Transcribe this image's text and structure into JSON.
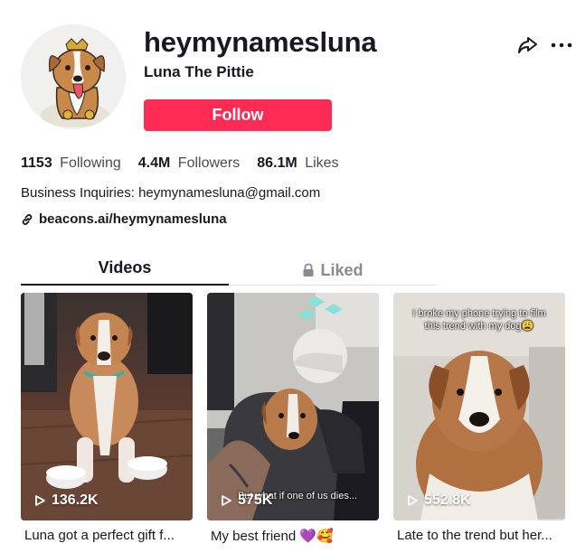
{
  "profile": {
    "username": "heymynamesluna",
    "nickname": "Luna The Pittie",
    "follow_label": "Follow"
  },
  "stats": [
    {
      "value": "1153",
      "label": "Following"
    },
    {
      "value": "4.4M",
      "label": "Followers"
    },
    {
      "value": "86.1M",
      "label": "Likes"
    }
  ],
  "bio": "Business Inquiries: heymynamesluna@gmail.com",
  "link": "beacons.ai/heymynamesluna",
  "tabs": [
    {
      "label": "Videos",
      "icon": "none"
    },
    {
      "label": "Liked",
      "icon": "lock-icon"
    }
  ],
  "videos": [
    {
      "views": "136.2K",
      "caption": "Luna got a perfect gift f...",
      "overlay": ""
    },
    {
      "views": "575K",
      "caption": "My best friend 💜🥰",
      "overlay": "But what if one of us dies..."
    },
    {
      "views": "552.8K",
      "caption": "Late to the trend but her...",
      "overlay": "I broke my phone trying to film this trend with my dog😩"
    }
  ],
  "colors": {
    "accent": "#fe2c55",
    "text": "#161823",
    "muted": "#8a8b91"
  }
}
